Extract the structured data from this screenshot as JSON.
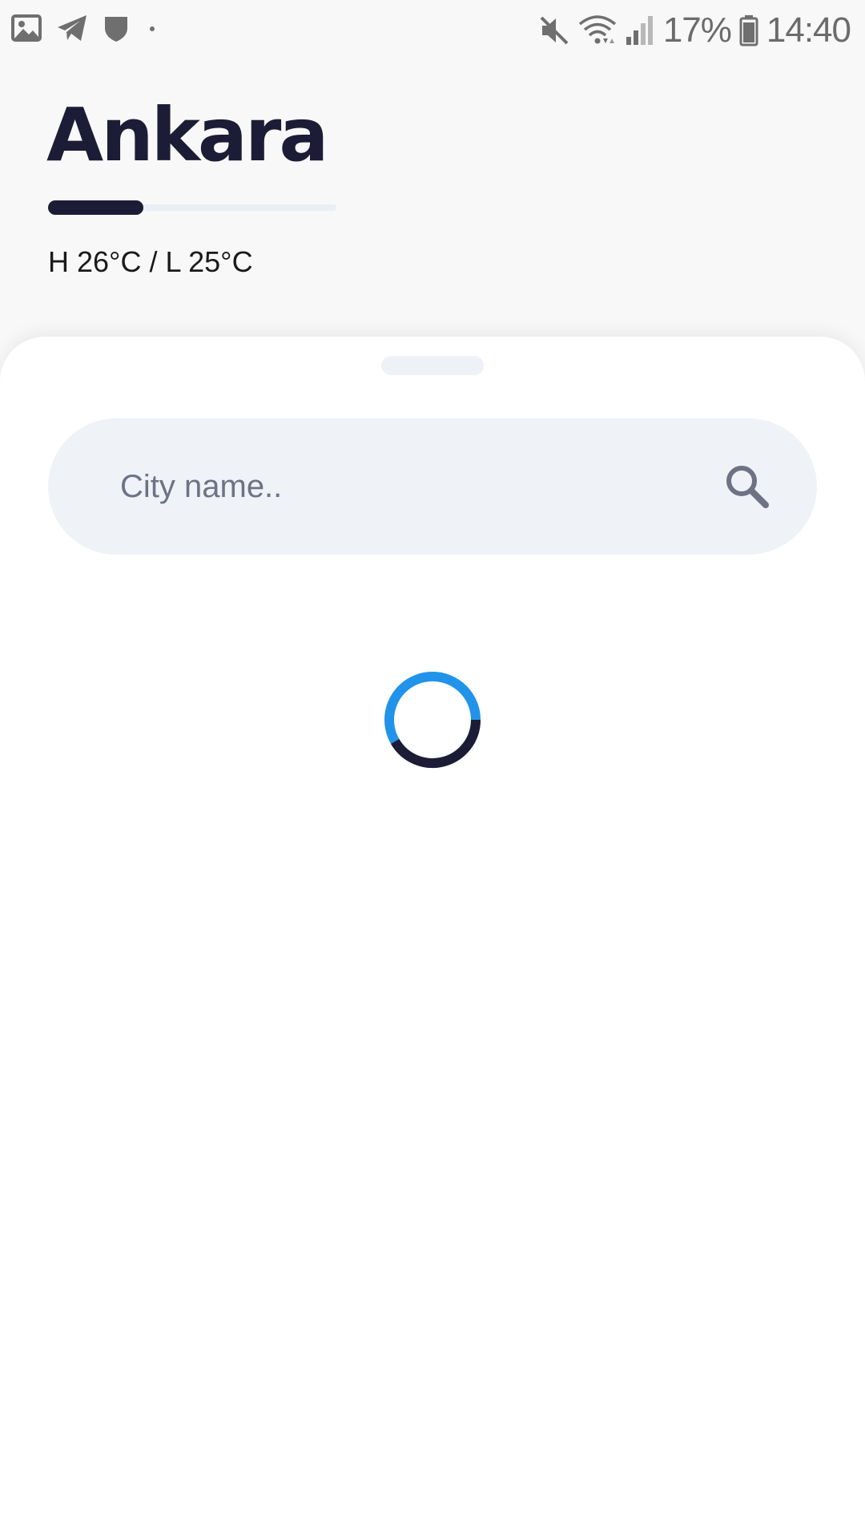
{
  "status_bar": {
    "battery": "17%",
    "time": "14:40",
    "left_icons": [
      "gallery-icon",
      "telegram-icon",
      "shield-icon",
      "dot-icon"
    ],
    "right_icons": [
      "mute-icon",
      "wifi-icon",
      "signal-icon",
      "battery-icon"
    ]
  },
  "header": {
    "city": "Ankara",
    "temp_range": "H 26°C / L 25°C",
    "progress": 0.33
  },
  "search": {
    "placeholder": "City name.."
  },
  "colors": {
    "title": "#1c1c36",
    "spinner_accent": "#2193ea",
    "spinner_dark": "#1c1c36",
    "search_bg": "#eff2f7"
  }
}
